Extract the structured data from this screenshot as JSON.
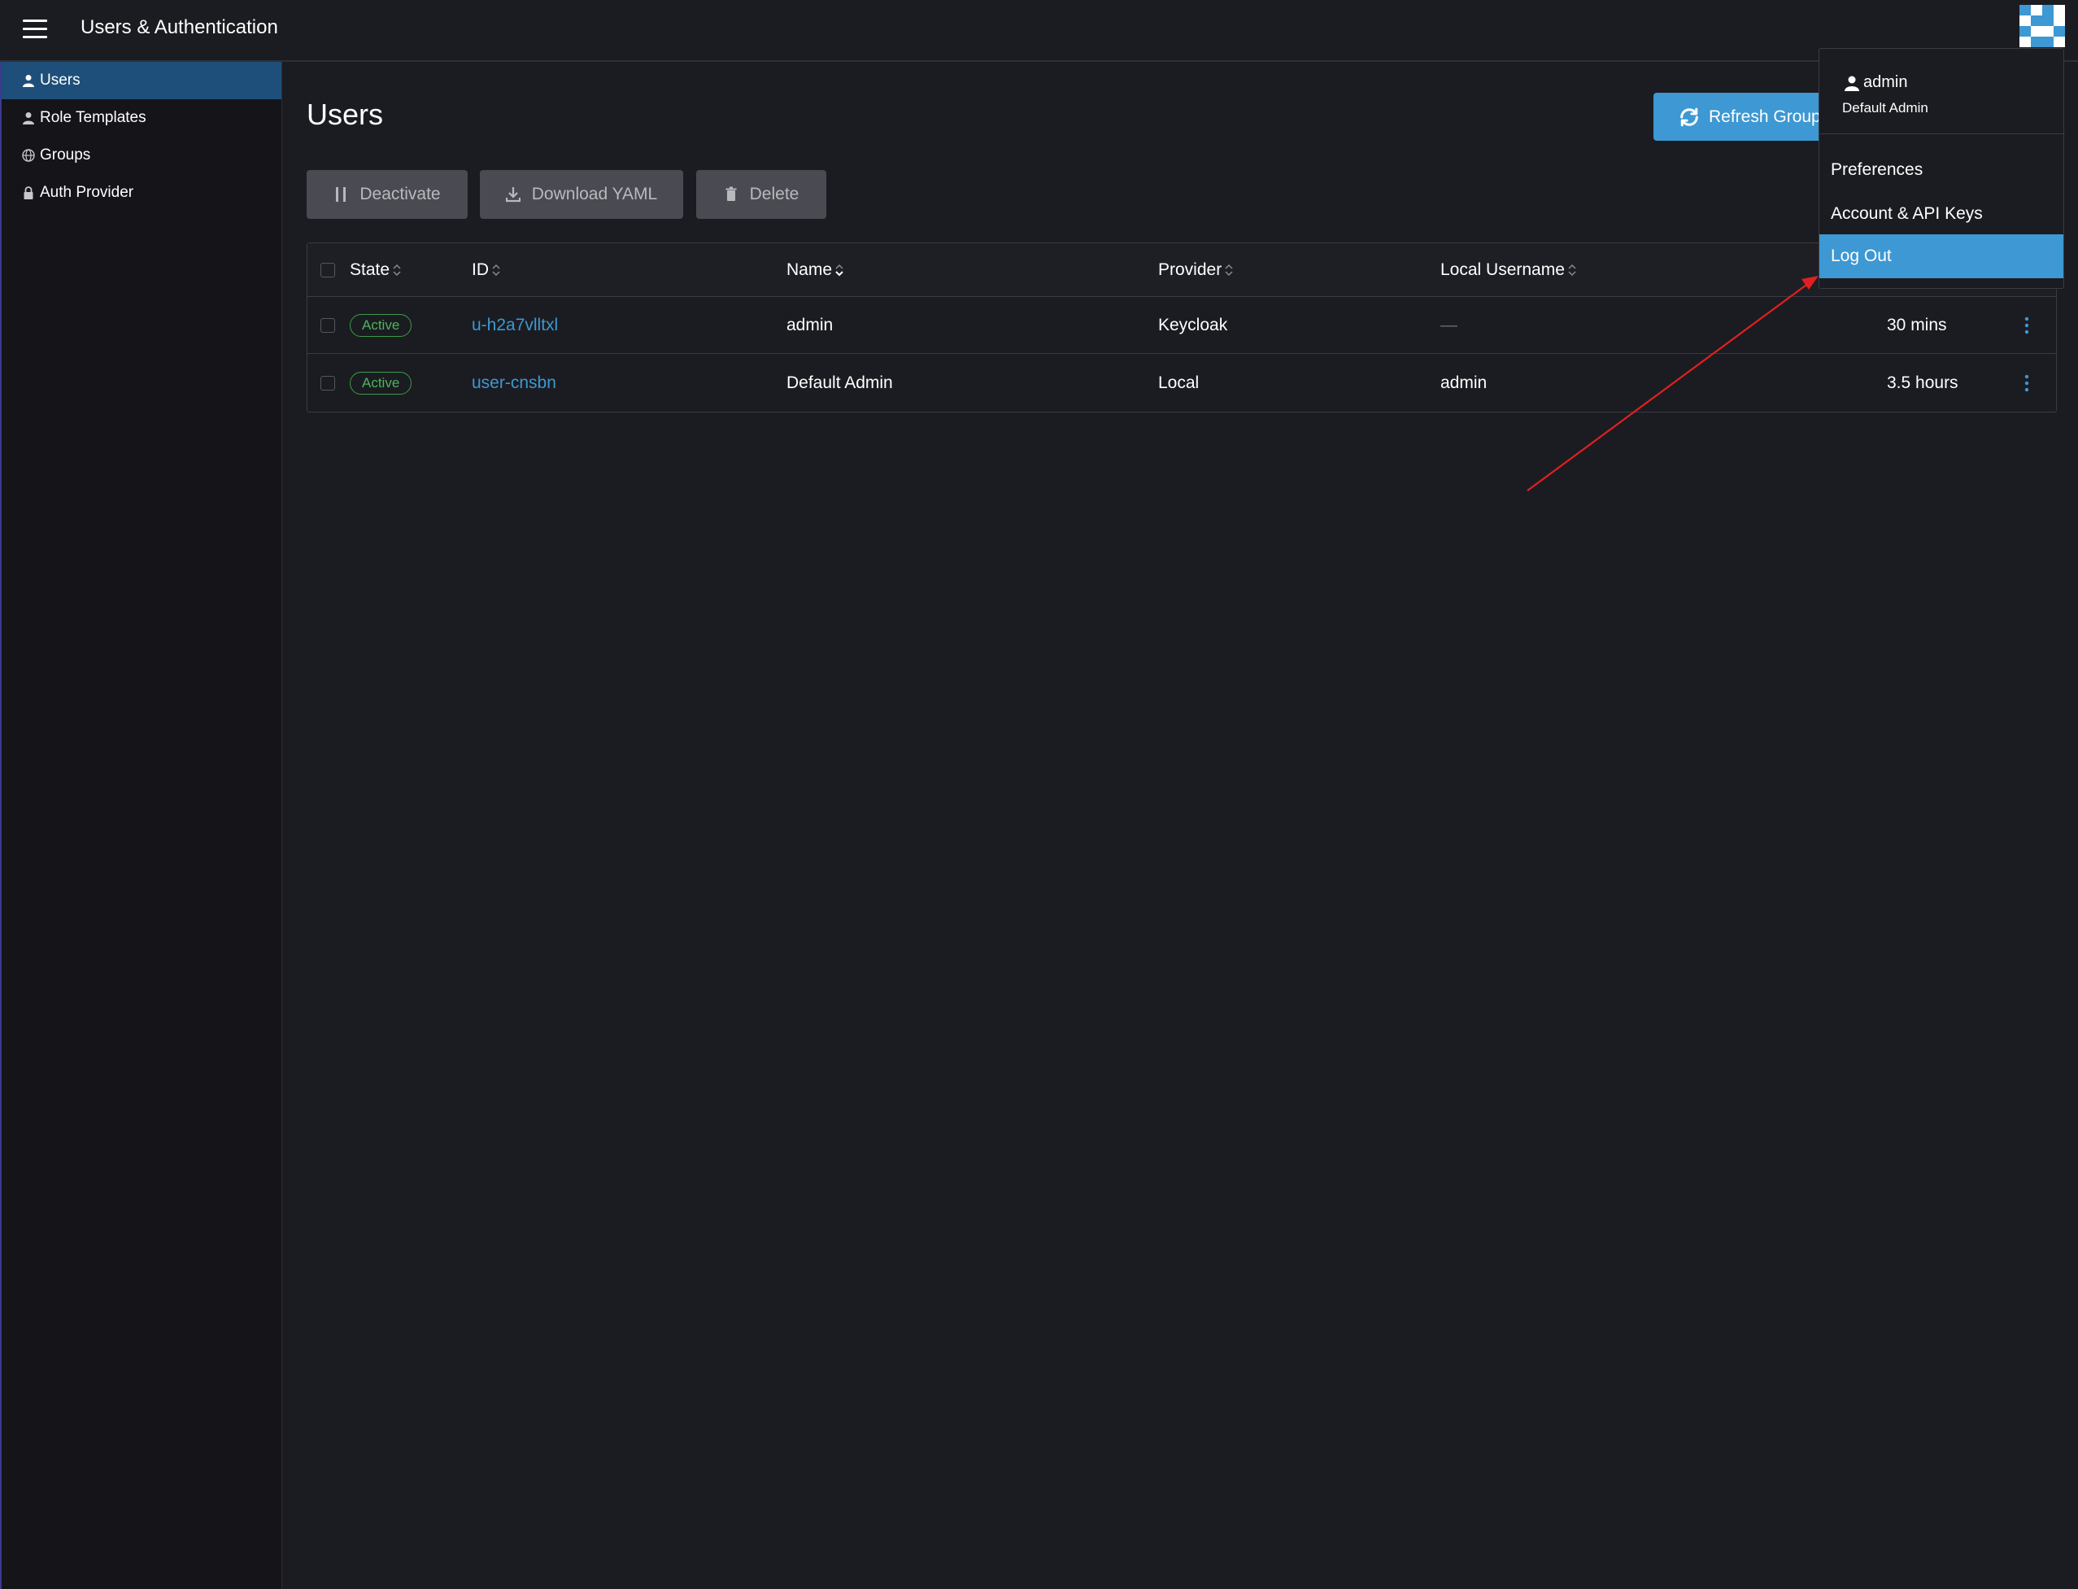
{
  "header": {
    "app_title": "Users & Authentication",
    "menu_icon": "hamburger-menu-icon",
    "avatar_icon": "user-avatar-icon"
  },
  "sidebar": {
    "items": [
      {
        "label": "Users",
        "icon": "user-icon",
        "active": true
      },
      {
        "label": "Role Templates",
        "icon": "user-icon",
        "active": false
      },
      {
        "label": "Groups",
        "icon": "globe-icon",
        "active": false
      },
      {
        "label": "Auth Provider",
        "icon": "lock-icon",
        "active": false
      }
    ]
  },
  "main": {
    "title": "Users",
    "refresh_label": "Refresh Group",
    "bulk_actions": {
      "deactivate": "Deactivate",
      "download_yaml": "Download YAML",
      "delete": "Delete"
    }
  },
  "table": {
    "columns": {
      "state": "State",
      "id": "ID",
      "name": "Name",
      "provider": "Provider",
      "local_username": "Local Username"
    },
    "rows": [
      {
        "state": "Active",
        "id": "u-h2a7vlltxl",
        "name": "admin",
        "provider": "Keycloak",
        "local_username": "—",
        "age": "30 mins"
      },
      {
        "state": "Active",
        "id": "user-cnsbn",
        "name": "Default Admin",
        "provider": "Local",
        "local_username": "admin",
        "age": "3.5 hours"
      }
    ]
  },
  "user_menu": {
    "username": "admin",
    "display_name": "Default Admin",
    "items": {
      "preferences": "Preferences",
      "account": "Account & API Keys",
      "logout": "Log Out"
    }
  },
  "colors": {
    "accent": "#3d98d3",
    "active_nav": "#1e4f7a",
    "status_active": "#4fb25f",
    "annotation_arrow": "#e02020",
    "background": "#1b1c21"
  }
}
